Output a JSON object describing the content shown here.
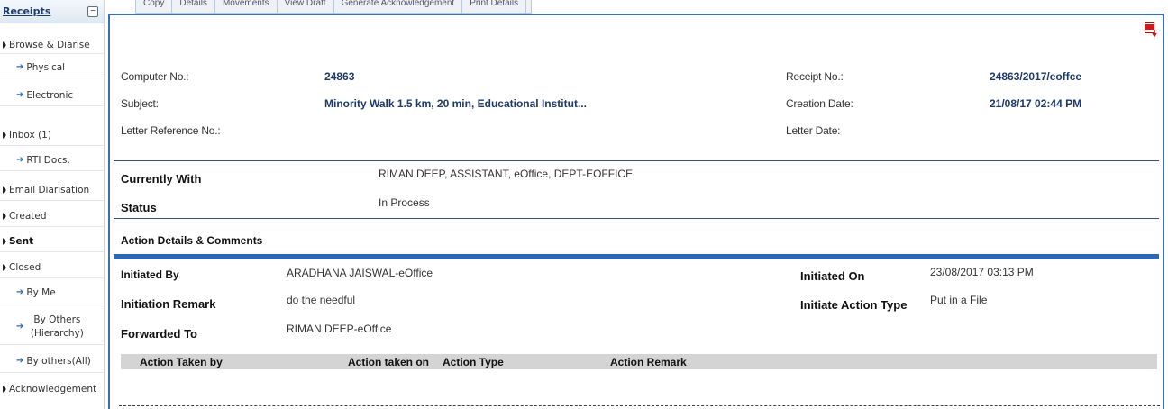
{
  "sidebar": {
    "title": "Receipts",
    "collapse_symbol": "−",
    "items": [
      {
        "label": "Browse & Diarise"
      },
      {
        "label": "Physical"
      },
      {
        "label": "Electronic"
      },
      {
        "label": "Inbox (1)"
      },
      {
        "label": "RTI Docs."
      },
      {
        "label": "Email Diarisation"
      },
      {
        "label": "Created"
      },
      {
        "label": "Sent"
      },
      {
        "label": "Closed"
      },
      {
        "label": "By Me"
      },
      {
        "label": "By Others (Hierarchy)"
      },
      {
        "label": "By others(All)"
      },
      {
        "label": "Acknowledgement"
      }
    ]
  },
  "tabs": [
    "Copy",
    "Details",
    "Movements",
    "View Draft",
    "Generate Acknowledgement",
    "Print Details"
  ],
  "receipt": {
    "computer_no_label": "Computer No.:",
    "computer_no": "24863",
    "subject_label": "Subject:",
    "subject": "Minority Walk 1.5 km, 20 min, Educational Institut...",
    "letter_ref_label": "Letter Reference No.:",
    "letter_ref": "",
    "receipt_no_label": "Receipt No.:",
    "receipt_no": "24863/2017/eoffce",
    "creation_date_label": "Creation Date:",
    "creation_date": "21/08/17 02:44 PM",
    "letter_date_label": "Letter Date:",
    "letter_date": ""
  },
  "status_block": {
    "currently_with_label": "Currently With",
    "currently_with": "RIMAN DEEP, ASSISTANT, eOffice, DEPT-EOFFICE",
    "status_label": "Status",
    "status": "In Process"
  },
  "action": {
    "section_title": "Action Details & Comments",
    "initiated_by_label": "Initiated By",
    "initiated_by": "ARADHANA JAISWAL-eOffice",
    "initiation_remark_label": "Initiation Remark",
    "initiation_remark": "do the needful",
    "forwarded_to_label": "Forwarded To",
    "forwarded_to": "RIMAN DEEP-eOffice",
    "initiated_on_label": "Initiated On",
    "initiated_on": "23/08/2017 03:13 PM",
    "action_type_label": "Initiate Action Type",
    "action_type": "Put in a File",
    "table_headers": [
      "Action Taken by",
      "Action taken on",
      "Action Type",
      "Action Remark"
    ]
  },
  "icons": {
    "pdf": "pdf-export-icon",
    "arrow": "blue-arrow-icon",
    "expand": "triangle-right-icon"
  },
  "colors": {
    "accent": "#2e67b5",
    "value_text": "#1e3a6a",
    "pdf_red": "#d11a1a"
  }
}
